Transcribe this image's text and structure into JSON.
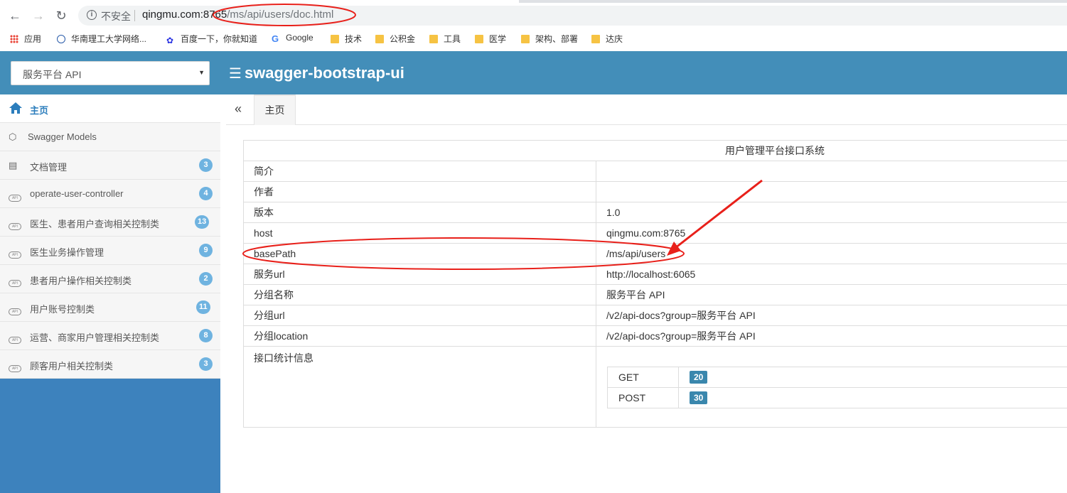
{
  "browser": {
    "insecure_label": "不安全",
    "url_host": "qingmu.com:8765",
    "url_path": "/ms/api/users/doc.html",
    "bookmarks": [
      {
        "label": "应用",
        "icon": "apps-grid-icon"
      },
      {
        "label": "华南理工大学网络...",
        "icon": "university-icon"
      },
      {
        "label": "百度一下，你就知道",
        "icon": "baidu-paw-icon"
      },
      {
        "label": "Google",
        "icon": "google-icon"
      },
      {
        "label": "技术",
        "icon": "folder-icon"
      },
      {
        "label": "公积金",
        "icon": "folder-icon"
      },
      {
        "label": "工具",
        "icon": "folder-icon"
      },
      {
        "label": "医学",
        "icon": "folder-icon"
      },
      {
        "label": "架构、部署",
        "icon": "folder-icon"
      },
      {
        "label": "达庆",
        "icon": "folder-icon"
      }
    ]
  },
  "header": {
    "group_select": "服务平台 API",
    "brand": "swagger-bootstrap-ui",
    "brand_icon": "menu-lines-icon",
    "color": "#438eb9"
  },
  "sidebar": {
    "items": [
      {
        "label": "主页",
        "icon": "home-icon",
        "badge": ""
      },
      {
        "label": "Swagger Models",
        "icon": "cube-icon",
        "badge": ""
      },
      {
        "label": "文档管理",
        "icon": "document-gear-icon",
        "badge": "3"
      },
      {
        "label": "operate-user-controller",
        "icon": "api-cloud-icon",
        "badge": "4"
      },
      {
        "label": "医生、患者用户查询相关控制类",
        "icon": "api-cloud-icon",
        "badge": "13"
      },
      {
        "label": "医生业务操作管理",
        "icon": "api-cloud-icon",
        "badge": "9"
      },
      {
        "label": "患者用户操作相关控制类",
        "icon": "api-cloud-icon",
        "badge": "2"
      },
      {
        "label": "用户账号控制类",
        "icon": "api-cloud-icon",
        "badge": "11"
      },
      {
        "label": "运营、商家用户管理相关控制类",
        "icon": "api-cloud-icon",
        "badge": "8"
      },
      {
        "label": "顾客用户相关控制类",
        "icon": "api-cloud-icon",
        "badge": "3"
      }
    ]
  },
  "tabs": {
    "collapse": "«",
    "active": "主页"
  },
  "info": {
    "title": "用户管理平台接口系统",
    "rows": [
      {
        "key": "简介",
        "value": ""
      },
      {
        "key": "作者",
        "value": ""
      },
      {
        "key": "版本",
        "value": "1.0"
      },
      {
        "key": "host",
        "value": "qingmu.com:8765"
      },
      {
        "key": "basePath",
        "value": "/ms/api/users"
      },
      {
        "key": "服务url",
        "value": "http://localhost:6065"
      },
      {
        "key": "分组名称",
        "value": "服务平台 API"
      },
      {
        "key": "分组url",
        "value": "/v2/api-docs?group=服务平台 API"
      },
      {
        "key": "分组location",
        "value": "/v2/api-docs?group=服务平台 API"
      }
    ],
    "stats_label": "接口统计信息",
    "stats": [
      {
        "method": "GET",
        "count": "20"
      },
      {
        "method": "POST",
        "count": "30"
      }
    ]
  },
  "annotation_color": "#e8201a"
}
